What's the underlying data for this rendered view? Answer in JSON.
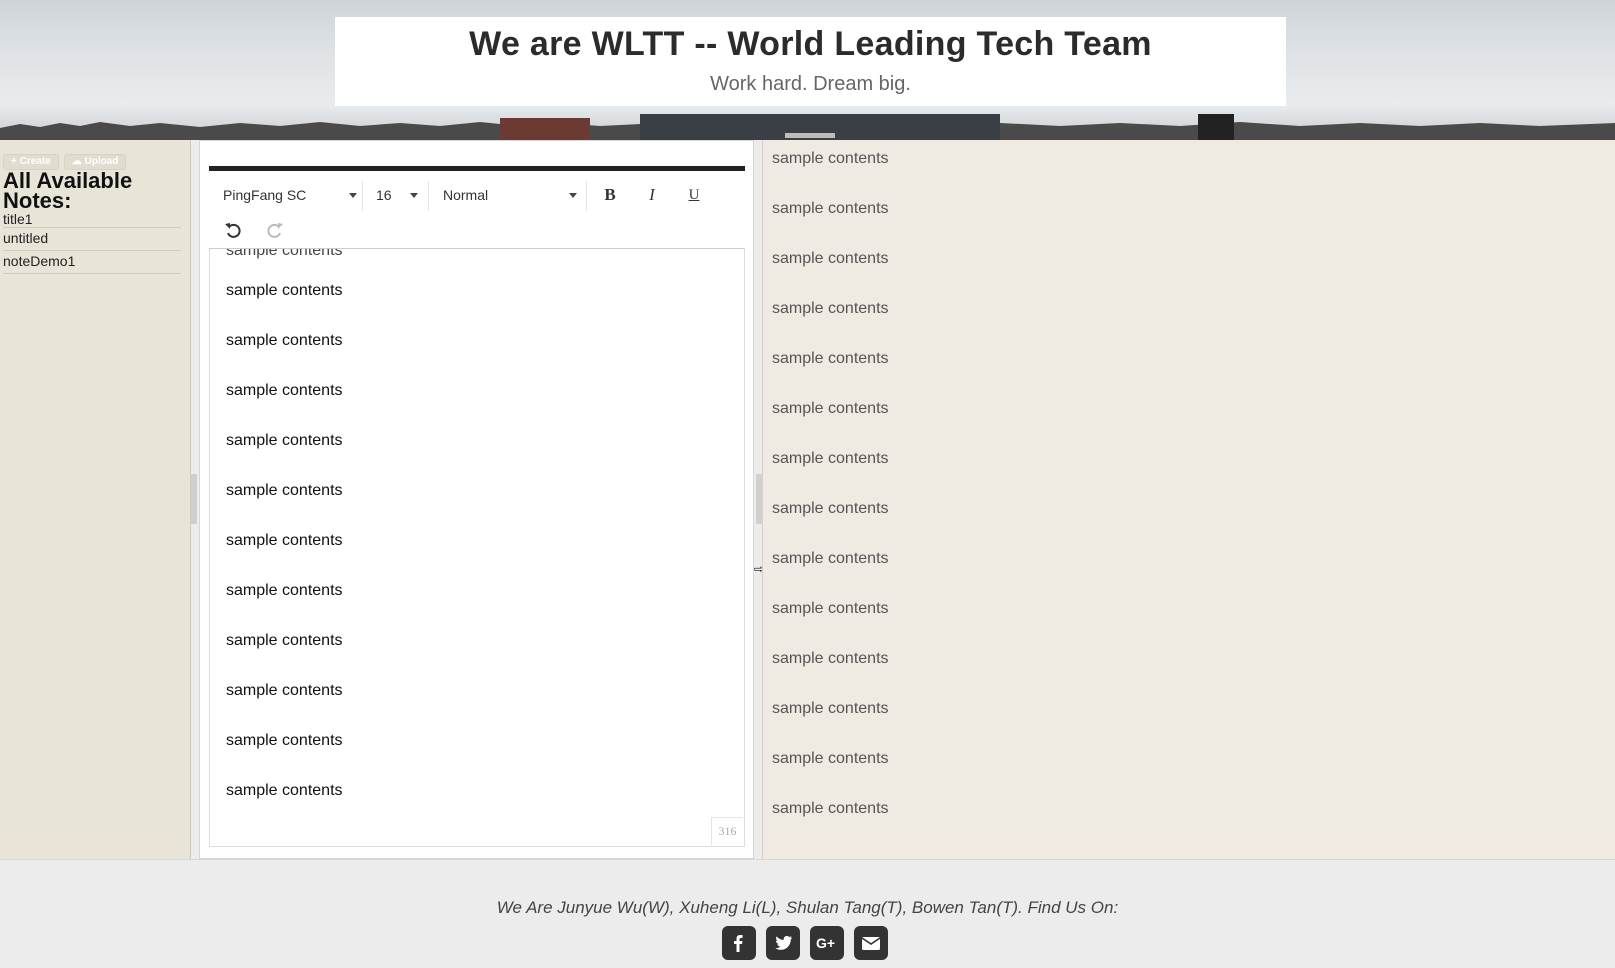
{
  "header": {
    "title": "We are WLTT -- World Leading Tech Team",
    "subtitle": "Work hard. Dream big."
  },
  "sidebar": {
    "create_label": "+ Create",
    "upload_label": "☁ Upload",
    "heading": "All Available Notes:",
    "notes": [
      "title1",
      "untitled",
      "noteDemo1"
    ]
  },
  "editor": {
    "toolbar": {
      "font_family": "PingFang SC",
      "font_size": "16",
      "heading": "Normal",
      "bold": "B",
      "italic": "I",
      "underline": "U"
    },
    "lines": [
      "sample contents",
      "sample contents",
      "sample contents",
      "sample contents",
      "sample contents",
      "sample contents",
      "sample contents",
      "sample contents",
      "sample contents",
      "sample contents",
      "sample contents"
    ],
    "char_count": "316"
  },
  "preview": {
    "lines": [
      "sample contents",
      "sample contents",
      "sample contents",
      "sample contents",
      "sample contents",
      "sample contents",
      "sample contents",
      "sample contents",
      "sample contents",
      "sample contents",
      "sample contents",
      "sample contents",
      "sample contents",
      "sample contents"
    ]
  },
  "footer": {
    "credits": "We Are Junyue Wu(W), Xuheng Li(L), Shulan Tang(T), Bowen Tan(T). Find Us On:",
    "social": [
      "facebook-icon",
      "twitter-icon",
      "google-plus-icon",
      "email-icon"
    ]
  },
  "colors": {
    "sidebar_bg": "#e8e5d8",
    "preview_bg": "#efebe3",
    "footer_bg": "#ececec",
    "icon_bg": "#333333"
  }
}
